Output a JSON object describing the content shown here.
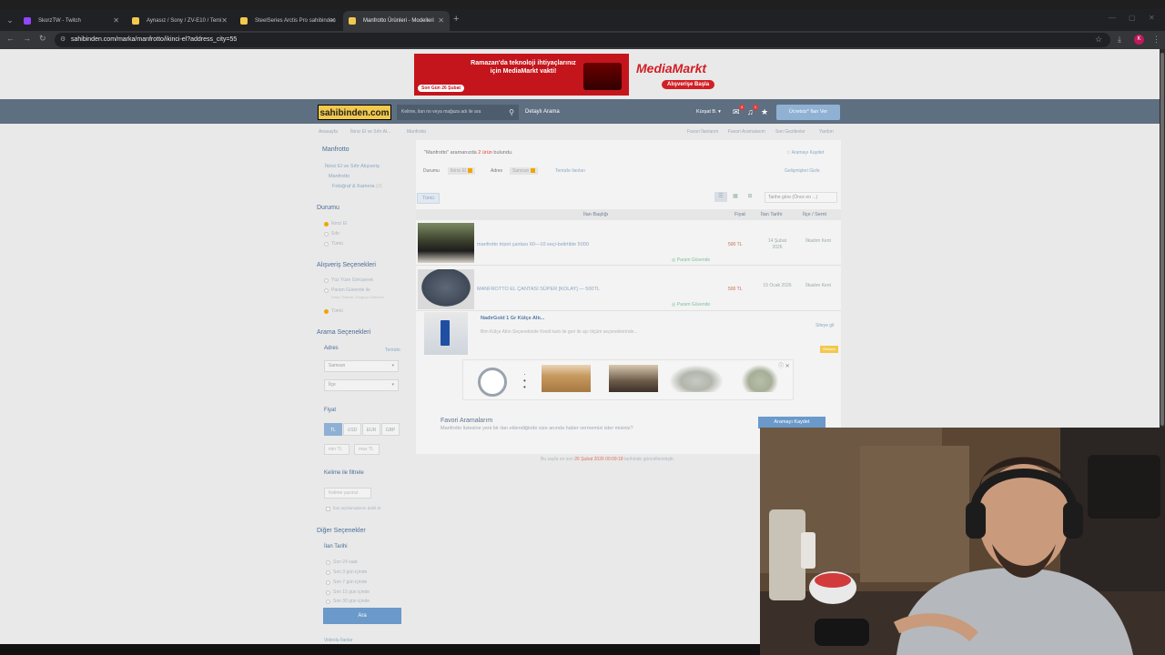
{
  "browser": {
    "tabs": [
      {
        "title": "SkorzTW - Twitch",
        "active": false,
        "color": "#9146ff"
      },
      {
        "title": "Aynasız / Sony / ZV-E10 / Temi",
        "active": false,
        "color": "#f2c94c"
      },
      {
        "title": "SteelSeries Arctis Pro sahibinden",
        "active": false,
        "color": "#f2c94c"
      },
      {
        "title": "Manfrotto Ürünleri - Modelleri",
        "active": true,
        "color": "#f2c94c"
      }
    ],
    "url": "sahibinden.com/marka/manfrotto/ikinci-el?address_city=55",
    "profile_initial": "K"
  },
  "banner": {
    "headline": "Ramazan'da teknoloji ihtiyaçlarınız için MediaMarkt vakti!",
    "badge": "Son Gün 26 Şubat",
    "brand": "MediaMarkt",
    "cta": "Alışverişe Başla"
  },
  "header": {
    "logo": "sahibinden.com",
    "search_placeholder": "Kelime, ilan no veya mağaza adı ile ara",
    "detailed_search": "Detaylı Arama",
    "user": "Kürşat B.",
    "notif_count": "1",
    "msg_count": "4",
    "post_ad": "Ücretsiz* İlan Ver"
  },
  "breadcrumb": [
    "Anasayfa",
    "İkinci El ve Sıfır Al...",
    "Manfrotto"
  ],
  "top_links": [
    "Favori İlanlarım",
    "Favori Aramalarım",
    "Son Gezilenler",
    "Yardım"
  ],
  "sidebar": {
    "title": "Manfrotto",
    "categories": [
      "İkinci El ve Sıfır Alışveriş",
      "Manfrotto",
      "Fotoğraf & Kamera"
    ],
    "category_count": "(2)",
    "durumu_label": "Durumu",
    "durumu_options": [
      "İkinci El",
      "Sıfır",
      "Tümü"
    ],
    "alisveris_label": "Alışveriş Seçenekleri",
    "alisveris_options": [
      "Yüz Yüze Görüşerek",
      "Param Güvende ile",
      "Tümü"
    ],
    "param_note": "Satıcı Öderse, Kargoya Ödemeli",
    "arama_label": "Arama Seçenekleri",
    "adres_label": "Adres",
    "adres_clear": "Temizle",
    "city": "Samsun",
    "district": "İlçe",
    "fiyat_label": "Fiyat",
    "currencies": [
      "TL",
      "USD",
      "EUR",
      "GBP"
    ],
    "min": "min TL",
    "max": "max TL",
    "keyword_label": "Kelime ile filtrele",
    "keyword_placeholder": "Kelime yazınız",
    "keyword_check": "İlan açıklamalarını dahil et",
    "diger_label": "Diğer Seçenekler",
    "tarih_label": "İlan Tarihi",
    "tarih_options": [
      "Son 24 saat",
      "Son 3 gün içinde",
      "Son 7 gün içinde",
      "Son 15 gün içinde",
      "Son 30 gün içinde"
    ],
    "search_button": "Ara",
    "video_link": "Videolu İlanlar"
  },
  "results": {
    "query": "\"Manfrotto\"",
    "text_mid": "aramanızda",
    "count": "2 ürün",
    "text_end": "bulundu.",
    "save_search": "Aramayı Kaydet",
    "filter_durumu": "Durumu",
    "chip_durumu": "İkinci El",
    "filter_adres": "Adres",
    "chip_adres": "Samsun",
    "clear_filters": "Temizle ilanları",
    "toggle": "Gelişmişleri Gizle",
    "tab": "Tümü",
    "sort": "Tarihe göre (Önce en ...)",
    "columns": {
      "title": "İlan Başlığı",
      "price": "Fiyat",
      "date": "İlan Tarihi",
      "location": "İlçe / Semt"
    },
    "rows": [
      {
        "title": "manfrotto tripot çantası 60—10 seçi-belirtilde 5000",
        "price": "500 TL",
        "date": "14 Şubat 2026",
        "location": "İlkadım Kent",
        "badge": "Param Güvende"
      },
      {
        "title": "MANFROTTO EL ÇANTASI SÜPER [KOLAY] — 500TL",
        "price": "500 TL",
        "date": "15 Ocak 2026",
        "location": "İlkadım Kent",
        "badge": "Param Güvende"
      }
    ],
    "ad_title": "NadirGold 1 Gr Külçe Altı...",
    "ad_desc": "Bim Külçe Altın Seçenekinde Kredi kartı ile geri ile ayı ölçüm seçeneklerinde...",
    "ad_go": "Siteye git",
    "ad_label": "Reklam"
  },
  "favorites": {
    "title": "Favori Aramalarım",
    "desc": "Manfrotto listesine yeni bir ilan eklendiğinde size anında haber vermemizi ister misiniz?",
    "button": "Aramayı Kaydet",
    "updated_prefix": "Bu sayfa en son",
    "updated_date": "26 Şubat 2026 00:09:18",
    "updated_suffix": "tarihinde güncellenmiştir."
  },
  "colors": {
    "header": "#5f6f82",
    "logo": "#f2c94c",
    "accent": "#6a99ca",
    "price": "#c46b55"
  }
}
